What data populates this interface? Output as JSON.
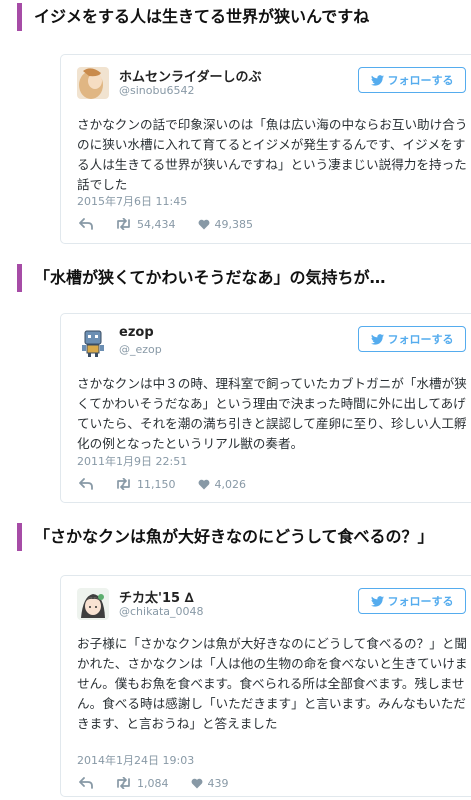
{
  "sections": [
    {
      "heading": "イジメをする人は生きてる世界が狭いんですね",
      "tweet": {
        "user_name": "ホムセンライダーしのぶ",
        "user_handle": "@sinobu6542",
        "follow_label": "フォローする",
        "text": "さかなクンの話で印象深いのは「魚は広い海の中ならお互い助け合うのに狭い水槽に入れて育てるとイジメが発生するんです、イジメをする人は生きてる世界が狭いんですね」という凄まじい説得力を持った話でした",
        "date": "2015年7月6日 11:45",
        "retweets": "54,434",
        "likes": "49,385",
        "avatar_icon": "photo-avatar"
      }
    },
    {
      "heading": "「水槽が狭くてかわいそうだなあ」の気持ちが…",
      "tweet": {
        "user_name": "ezop",
        "user_handle": "@_ezop",
        "follow_label": "フォローする",
        "text": "さかなクンは中３の時、理科室で飼っていたカブトガニが「水槽が狭くてかわいそうだなあ」という理由で決まった時間に外に出してあげていたら、それを潮の満ち引きと誤認して産卵に至り、珍しい人工孵化の例となったというリアル獣の奏者。",
        "date": "2011年1月9日 22:51",
        "retweets": "11,150",
        "likes": "4,026",
        "avatar_icon": "robot-avatar"
      }
    },
    {
      "heading": "「さかなクンは魚が大好きなのにどうして食べるの？」",
      "tweet": {
        "user_name": "チカ太'15 ∆",
        "user_handle": "@chikata_0048",
        "follow_label": "フォローする",
        "text": "お子様に「さかなクンは魚が大好きなのにどうして食べるの？」と聞かれた、さかなクンは「人は他の生物の命を食べないと生きていけません。僕もお魚を食べます。食べられる所は全部食べます。残しません。食べる時は感謝し「いただきます」と言います。みんなもいただきます、と言おうね」と答えました",
        "date": "2014年1月24日 19:03",
        "retweets": "1,084",
        "likes": "439",
        "avatar_icon": "anime-avatar"
      }
    }
  ],
  "colors": {
    "accent": "#a64ca6",
    "twitter_blue": "#55acee",
    "meta_gray": "#8899a6",
    "border": "#e1e8ed"
  }
}
